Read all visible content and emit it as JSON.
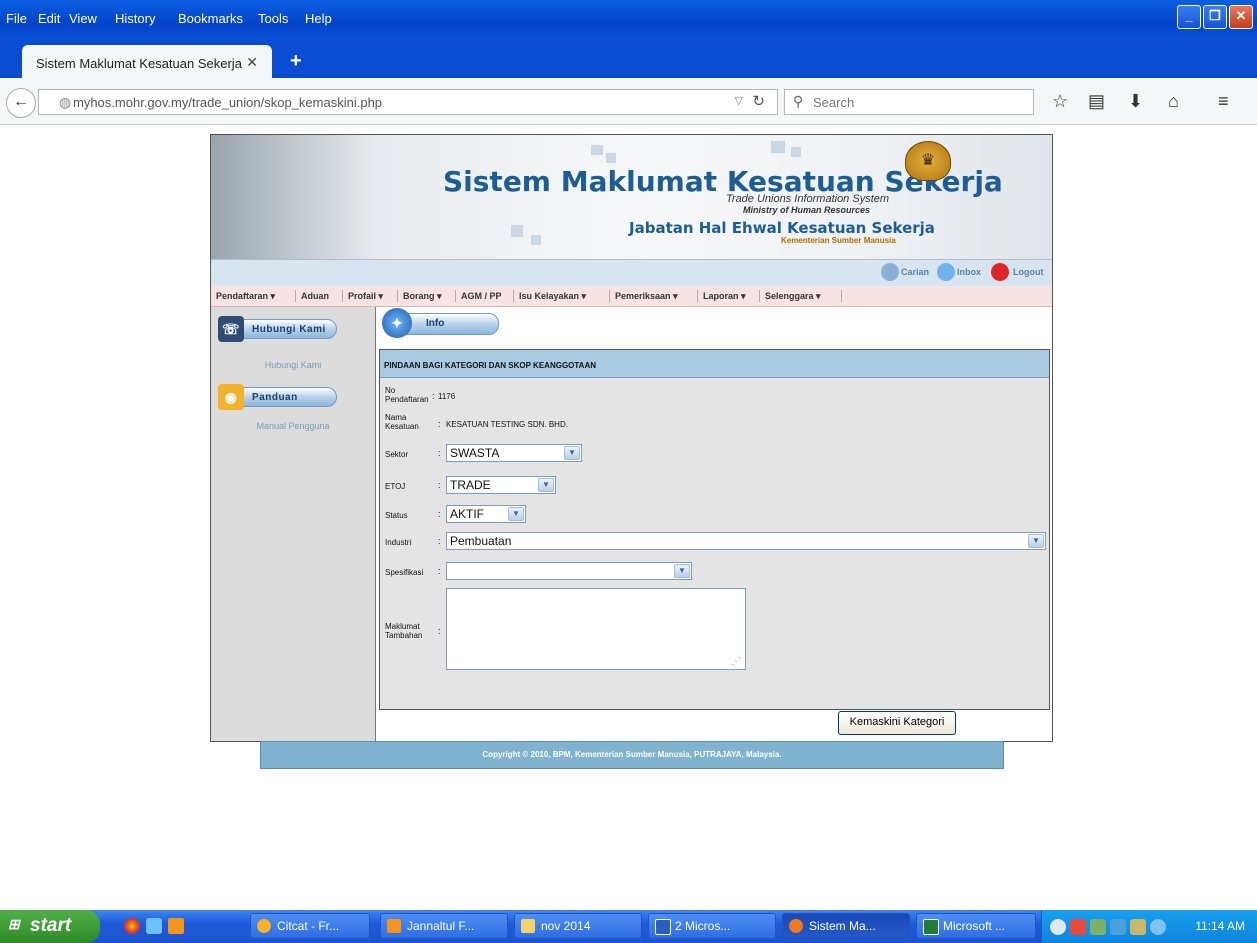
{
  "browser": {
    "menu": [
      "File",
      "Edit",
      "View",
      "History",
      "Bookmarks",
      "Tools",
      "Help"
    ],
    "tab_title": "Sistem Maklumat Kesatuan Sekerja",
    "tab_close": "✕",
    "new_tab": "+",
    "url": "myhos.mohr.gov.my/trade_union/skop_kemaskini.php",
    "search_placeholder": "Search"
  },
  "banner": {
    "title": "Sistem Maklumat Kesatuan Sekerja",
    "subtitle1": "Trade Unions Information System",
    "subtitle2": "Ministry of Human Resources",
    "dept": "Jabatan Hal Ehwal Kesatuan Sekerja",
    "ministry": "Kementerian Sumber Manusia"
  },
  "toolstrip": {
    "carian": "Carian",
    "inbox": "Inbox",
    "logout": "Logout"
  },
  "nav": [
    "Pendaftaran ▾",
    "Aduan",
    "Profail ▾",
    "Borang ▾",
    "AGM / PP",
    "Isu Kelayakan ▾",
    "Pemeriksaan ▾",
    "Laporan ▾",
    "Selenggara ▾"
  ],
  "sidebar": {
    "hubungi_btn": "Hubungi Kami",
    "hubungi_link": "Hubungi Kami",
    "panduan_btn": "Panduan",
    "panduan_link": "Manual Pengguna"
  },
  "info_btn": "Info",
  "form": {
    "heading": "PINDAAN BAGI KATEGORI DAN SKOP KEANGGOTAAN",
    "no_label_1": "No",
    "no_label_2": "Pendaftaran",
    "no_value": "1176",
    "nama_label_1": "Nama",
    "nama_label_2": "Kesatuan",
    "nama_value": "KESATUAN TESTING SDN. BHD.",
    "sektor_label": "Sektor",
    "sektor_value": "SWASTA",
    "etoj_label": "ETOJ",
    "etoj_value": "TRADE",
    "status_label": "Status",
    "status_value": "AKTIF",
    "industri_label": "Industri",
    "industri_value": "Pembuatan",
    "spesifikasi_label": "Spesifikasi",
    "spesifikasi_value": "",
    "maklumat_label_1": "Maklumat",
    "maklumat_label_2": "Tambahan",
    "colon": ":",
    "submit": "Kemaskini Kategori"
  },
  "footer": "Copyright © 2010, BPM, Kementerian Sumber Manusia, PUTRAJAYA, Malaysia.",
  "taskbar": {
    "start": "start",
    "buttons": [
      "Citcat - Fr...",
      "Jannaltul F...",
      "nov 2014",
      "2 Micros...",
      "Sistem Ma...",
      "Microsoft ..."
    ],
    "clock": "11:14 AM"
  }
}
